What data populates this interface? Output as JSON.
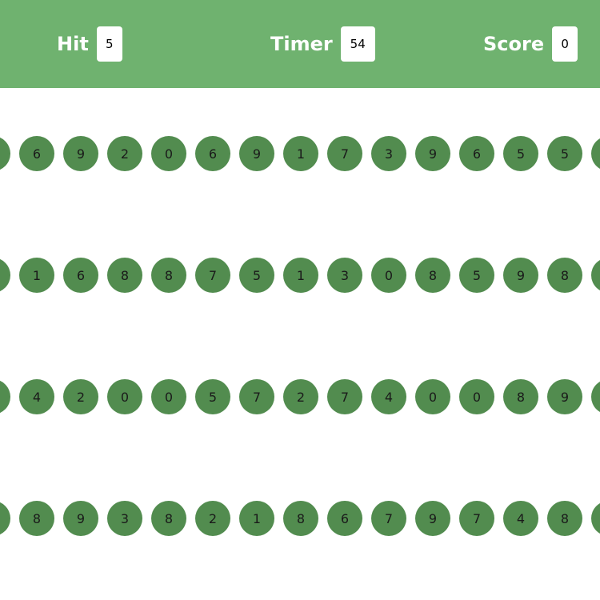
{
  "header": {
    "hit_label": "Hit",
    "hit_value": "5",
    "timer_label": "Timer",
    "timer_value": "54",
    "score_label": "Score",
    "score_value": "0"
  },
  "colors": {
    "header_bg": "#6fb26f",
    "ball": "#528c4f"
  },
  "rows": [
    [
      "",
      "6",
      "9",
      "2",
      "0",
      "6",
      "9",
      "1",
      "7",
      "3",
      "9",
      "6",
      "5",
      "5",
      ""
    ],
    [
      "",
      "1",
      "6",
      "8",
      "8",
      "7",
      "5",
      "1",
      "3",
      "0",
      "8",
      "5",
      "9",
      "8",
      ""
    ],
    [
      "",
      "4",
      "2",
      "0",
      "0",
      "5",
      "7",
      "2",
      "7",
      "4",
      "0",
      "0",
      "8",
      "9",
      ""
    ],
    [
      "",
      "8",
      "9",
      "3",
      "8",
      "2",
      "1",
      "8",
      "6",
      "7",
      "9",
      "7",
      "4",
      "8",
      ""
    ]
  ]
}
